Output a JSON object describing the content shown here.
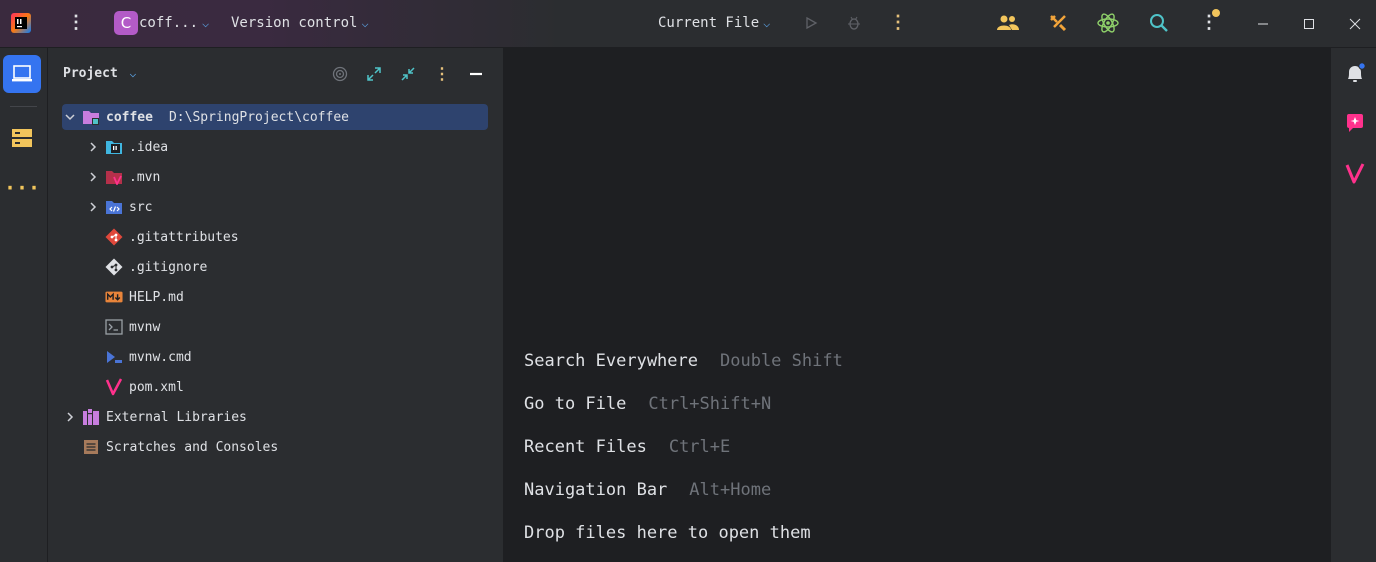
{
  "titlebar": {
    "project_initial": "C",
    "project_name": "coff...",
    "vcs_label": "Version control",
    "run_config": "Current File"
  },
  "icons": {
    "app_logo": "intellij-logo-icon",
    "main_menu": "kebab-menu-icon",
    "run": "run-icon",
    "debug": "debug-icon",
    "run_more": "more-vertical-icon",
    "code_with_me": "people-icon",
    "build": "hammer-icon",
    "ai": "atom-icon",
    "search": "search-icon",
    "settings": "settings-kebab-icon"
  },
  "project_panel": {
    "title": "Project",
    "tree": [
      {
        "name": "coffee",
        "path": "D:\\SpringProject\\coffee",
        "icon": "module-folder-icon",
        "expandable": true,
        "expanded": true,
        "selected": true
      },
      {
        "name": ".idea",
        "icon": "idea-folder-icon",
        "expandable": true
      },
      {
        "name": ".mvn",
        "icon": "maven-folder-icon",
        "expandable": true
      },
      {
        "name": "src",
        "icon": "source-folder-icon",
        "expandable": true
      },
      {
        "name": ".gitattributes",
        "icon": "git-file-icon",
        "expandable": false
      },
      {
        "name": ".gitignore",
        "icon": "gitignore-file-icon",
        "expandable": false
      },
      {
        "name": "HELP.md",
        "icon": "markdown-file-icon",
        "expandable": false
      },
      {
        "name": "mvnw",
        "icon": "shell-script-icon",
        "expandable": false
      },
      {
        "name": "mvnw.cmd",
        "icon": "cmd-script-icon",
        "expandable": false
      },
      {
        "name": "pom.xml",
        "icon": "maven-pom-icon",
        "expandable": false
      },
      {
        "name": "External Libraries",
        "icon": "libraries-icon",
        "expandable": true
      },
      {
        "name": "Scratches and Consoles",
        "icon": "scratches-icon",
        "expandable": false
      }
    ]
  },
  "editor": {
    "hints": [
      {
        "action": "Search Everywhere",
        "keys": "Double Shift"
      },
      {
        "action": "Go to File",
        "keys": "Ctrl+Shift+N"
      },
      {
        "action": "Recent Files",
        "keys": "Ctrl+E"
      },
      {
        "action": "Navigation Bar",
        "keys": "Alt+Home"
      },
      {
        "action": "Drop files here to open them",
        "keys": ""
      }
    ]
  },
  "colors": {
    "accent": "#3574f0",
    "selection": "#2e436e",
    "panel_bg": "#2b2d30",
    "editor_bg": "#1e1f22",
    "project_badge": "#b35bc7"
  }
}
